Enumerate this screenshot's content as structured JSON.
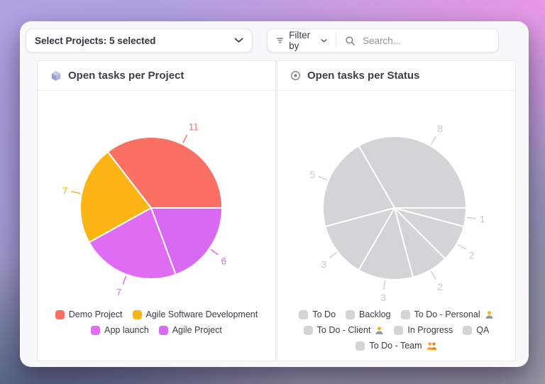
{
  "toolbar": {
    "select_projects_label": "Select Projects: 5 selected",
    "filter_label": "Filter by",
    "search_placeholder": "Search..."
  },
  "cards": [
    {
      "title": "Open tasks per Project"
    },
    {
      "title": "Open tasks per Status"
    }
  ],
  "theme": {
    "backdrop_top_left": "#b2a2e4",
    "backdrop_top_right": "#ee98e6",
    "backdrop_bottom_left": "#44607f",
    "backdrop_bottom_right": "#999ca4",
    "window_surface": "#f8f8fa",
    "card_surface": "#ffffff"
  },
  "chart_data": [
    {
      "type": "pie",
      "title": "Open tasks per Project",
      "start": "3-oclock",
      "direction": "counterclockwise",
      "total": 31,
      "slice_border_color": "#ffffff",
      "value_label_style": "colored-callouts",
      "series": [
        {
          "label": "Demo Project",
          "value": 11,
          "color": "#fa7062"
        },
        {
          "label": "Agile Software Development",
          "value": 7,
          "color": "#fcb515"
        },
        {
          "label": "App launch",
          "value": 7,
          "color": "#e06cf4"
        },
        {
          "label": "Agile Project",
          "value": 6,
          "color": "#d76af0"
        }
      ]
    },
    {
      "type": "pie",
      "title": "Open tasks per Status",
      "start": "3-oclock",
      "direction": "counterclockwise",
      "total": 24,
      "slice_border_color": "#ffffff",
      "label_color": "#c6c6ca",
      "label_line_color": "#d2d2d5",
      "series": [
        {
          "label": "To Do",
          "value": 8,
          "color": "#d4d4d7"
        },
        {
          "label": "Backlog",
          "value": 5,
          "color": "#d4d4d7"
        },
        {
          "label": "To Do - Personal",
          "value": 3,
          "color": "#d4d4d7",
          "emoji": "person"
        },
        {
          "label": "To Do - Client",
          "value": 3,
          "color": "#d4d4d7",
          "emoji": "person"
        },
        {
          "label": "In Progress",
          "value": 2,
          "color": "#d4d4d7"
        },
        {
          "label": "QA",
          "value": 2,
          "color": "#d4d4d7"
        },
        {
          "label": "To Do - Team",
          "value": 1,
          "color": "#d4d4d7",
          "emoji": "team"
        }
      ]
    }
  ]
}
